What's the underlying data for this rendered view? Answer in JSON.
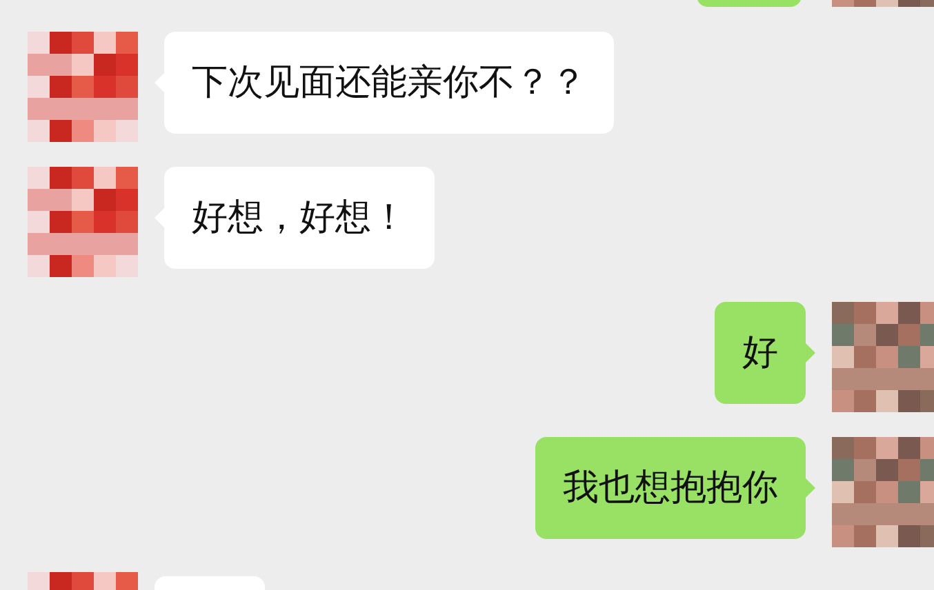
{
  "messages": [
    {
      "outgoing": true,
      "kind": "cut"
    },
    {
      "outgoing": false,
      "kind": "text",
      "text": "下次见面还能亲你不？？"
    },
    {
      "outgoing": false,
      "kind": "text",
      "text": "好想，好想！"
    },
    {
      "outgoing": true,
      "kind": "text",
      "text": "好"
    },
    {
      "outgoing": true,
      "kind": "text",
      "text": "我也想抱抱你"
    },
    {
      "outgoing": false,
      "kind": "cut"
    }
  ]
}
